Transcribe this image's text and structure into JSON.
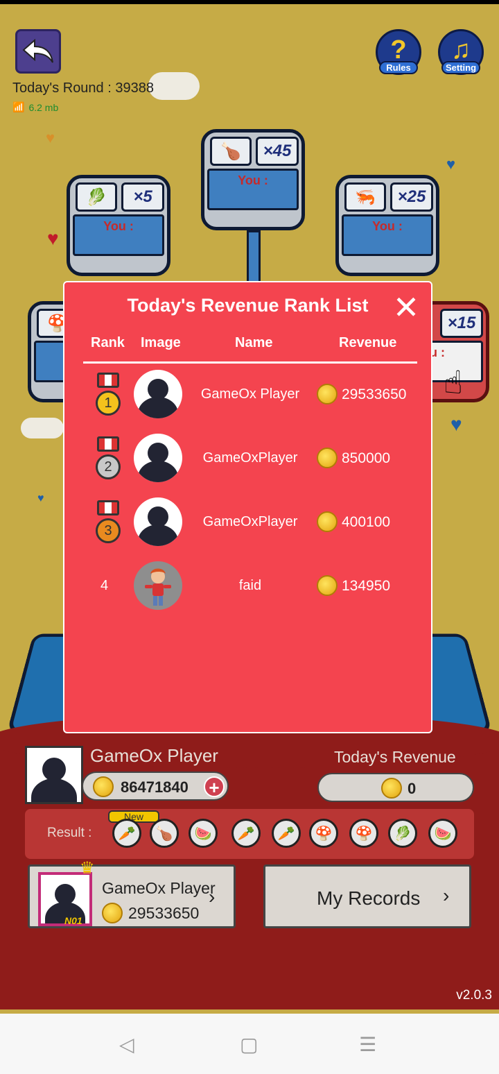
{
  "header": {
    "round_label": "Today's Round : 39388",
    "network": "6.2 mb",
    "rules_label": "Rules",
    "setting_label": "Setting"
  },
  "boxes": [
    {
      "icon": "🥬",
      "mult": "×5",
      "you": "You :"
    },
    {
      "icon": "🍗",
      "mult": "×45",
      "you": "You :"
    },
    {
      "icon": "🦐",
      "mult": "×25",
      "you": "You :"
    },
    {
      "icon": "🍄",
      "mult": "",
      "you": ""
    },
    {
      "icon": "",
      "mult": "×15",
      "you": "u :"
    }
  ],
  "modal": {
    "title": "Today's Revenue Rank List",
    "headers": {
      "rank": "Rank",
      "image": "Image",
      "name": "Name",
      "revenue": "Revenue"
    },
    "rows": [
      {
        "rank": "1",
        "name": "GameOx Player",
        "revenue": "29533650"
      },
      {
        "rank": "2",
        "name": "GameOxPlayer",
        "revenue": "850000"
      },
      {
        "rank": "3",
        "name": "GameOxPlayer",
        "revenue": "400100"
      },
      {
        "rank": "4",
        "name": "faid",
        "revenue": "134950"
      }
    ]
  },
  "player": {
    "name": "GameOx Player",
    "coins": "86471840"
  },
  "revenue": {
    "title": "Today's Revenue",
    "value": "0"
  },
  "result": {
    "label": "Result :",
    "new_badge": "New",
    "items": [
      "🥕",
      "🍗",
      "🍉",
      "🥕",
      "🥕",
      "🍄",
      "🍄",
      "🥬",
      "🍉"
    ]
  },
  "top_player": {
    "badge": "N01",
    "name": "GameOx Player",
    "coins": "29533650"
  },
  "records": {
    "label": "My Records"
  },
  "version": "v2.0.3",
  "colors": {
    "modal_bg": "#f4444f",
    "panel_bg": "#8f1c1a",
    "game_bg": "#c6ab46"
  }
}
